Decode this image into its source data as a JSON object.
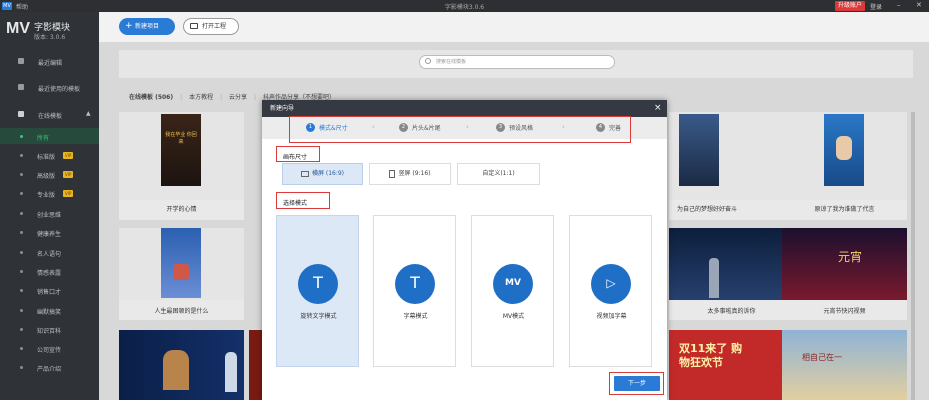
{
  "titlebar": {
    "logo": "MV",
    "help": "帮助",
    "title": "字影模块3.0.6",
    "upgrade": "升级账户",
    "login": "登录",
    "minimize": "–",
    "close": "✕"
  },
  "sidebar": {
    "brand_mv": "MV",
    "brand_name": "字影模块",
    "version": "版本: 3.0.6",
    "main_items": [
      {
        "label": "最近编辑"
      },
      {
        "label": "最近使用的模板"
      },
      {
        "label": "在线模板"
      }
    ],
    "sub_items": [
      {
        "label": "所有",
        "vip": ""
      },
      {
        "label": "标准版",
        "vip": "VIP"
      },
      {
        "label": "高级版",
        "vip": "VIP"
      },
      {
        "label": "专业版",
        "vip": "VIP"
      },
      {
        "label": "创业思维",
        "vip": ""
      },
      {
        "label": "健康养生",
        "vip": ""
      },
      {
        "label": "名人语句",
        "vip": ""
      },
      {
        "label": "情感表露",
        "vip": ""
      },
      {
        "label": "销售口才",
        "vip": ""
      },
      {
        "label": "幽默搞笑",
        "vip": ""
      },
      {
        "label": "知识百科",
        "vip": ""
      },
      {
        "label": "公司宣传",
        "vip": ""
      },
      {
        "label": "产品介绍",
        "vip": ""
      }
    ]
  },
  "toolbar": {
    "new_project": "新建项目",
    "open_project": "打开工程"
  },
  "search": {
    "placeholder": "搜索在线模板"
  },
  "filters": {
    "online": "在线模板 (506)",
    "items": [
      "本方教程",
      "云分享",
      "抖声作品分享（不想要吧）"
    ]
  },
  "cards": [
    {
      "caption": "开学的心情",
      "poster_text": "我在毕业 你回来"
    },
    {
      "caption": "人生最困顿的是什么",
      "poster_text": ""
    },
    {
      "caption": "为自己的梦想好好奋斗",
      "poster_text": ""
    },
    {
      "caption": "原谅了我为谁做了代言",
      "poster_text": ""
    },
    {
      "caption": "太多事啦真的诉你",
      "poster_text": ""
    },
    {
      "caption": "元宵节快闪视频",
      "poster_text": "元宵"
    },
    {
      "caption": "",
      "poster_text": "双11来了 购物狂欢节"
    },
    {
      "caption": "",
      "poster_text": "相自己在一"
    }
  ],
  "modal": {
    "title": "新建向导",
    "close": "×",
    "steps": [
      {
        "num": "1",
        "label": "模式&尺寸"
      },
      {
        "num": "2",
        "label": "片头&片尾"
      },
      {
        "num": "3",
        "label": "预设风格"
      },
      {
        "num": "4",
        "label": "完善"
      }
    ],
    "canvas_size_title": "画布尺寸",
    "ratios": [
      {
        "label": "横屏 (16:9)"
      },
      {
        "label": "竖屏 (9:16)"
      },
      {
        "label": "自定义(1:1)"
      }
    ],
    "mode_title": "选择模式",
    "modes": [
      {
        "label": "旋转文字模式",
        "glyph": "T"
      },
      {
        "label": "字幕模式",
        "glyph": "T"
      },
      {
        "label": "MV模式",
        "glyph": "MV"
      },
      {
        "label": "视频加字幕",
        "glyph": "▷"
      }
    ],
    "next": "下一步"
  }
}
